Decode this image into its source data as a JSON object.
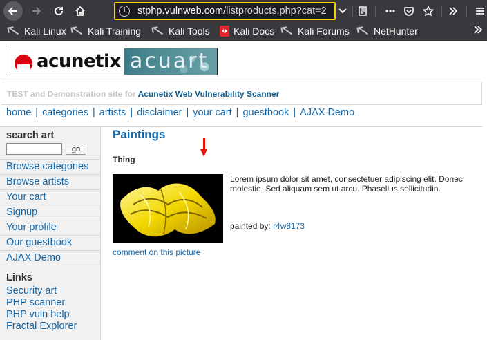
{
  "browser": {
    "url_host": "stphp.vulnweb.com",
    "url_path": "/listproducts.php?cat=2",
    "bookmarks": [
      {
        "label": "Kali Linux",
        "icon": "kali-dragon-icon"
      },
      {
        "label": "Kali Training",
        "icon": "kali-dragon-icon"
      },
      {
        "label": "Kali Tools",
        "icon": "kali-dragon-icon"
      },
      {
        "label": "Kali Docs",
        "icon": "kali-docs-icon"
      },
      {
        "label": "Kali Forums",
        "icon": "kali-dragon-icon"
      },
      {
        "label": "NetHunter",
        "icon": "kali-dragon-icon"
      }
    ]
  },
  "logo": {
    "brand": "acunetix",
    "product": "acuart"
  },
  "banner": {
    "prefix": "TEST and Demonstration site for",
    "highlight": "Acunetix Web Vulnerability Scanner"
  },
  "nav": [
    "home",
    "categories",
    "artists",
    "disclaimer",
    "your cart",
    "guestbook",
    "AJAX Demo"
  ],
  "sidebar": {
    "search_title": "search art",
    "search_value": "",
    "go_label": "go",
    "links": [
      "Browse categories",
      "Browse artists",
      "Your cart",
      "Signup",
      "Your profile",
      "Our guestbook",
      "AJAX Demo"
    ],
    "links_title": "Links",
    "external_links": [
      "Security art",
      "PHP scanner",
      "PHP vuln help",
      "Fractal Explorer"
    ]
  },
  "content": {
    "title": "Paintings",
    "item_title": "Thing",
    "description": "Lorem ipsum dolor sit amet, consectetuer adipiscing elit. Donec molestie. Sed aliquam sem ut arcu. Phasellus sollicitudin.",
    "painted_by_label": "painted by:",
    "painter": "r4w8173",
    "comment_link": "comment on this picture"
  },
  "colors": {
    "link": "#1366a8",
    "accent": "#0e5c8d",
    "chrome": "#38383d",
    "url_highlight": "#f0d100",
    "arrow": "#e6140c"
  }
}
